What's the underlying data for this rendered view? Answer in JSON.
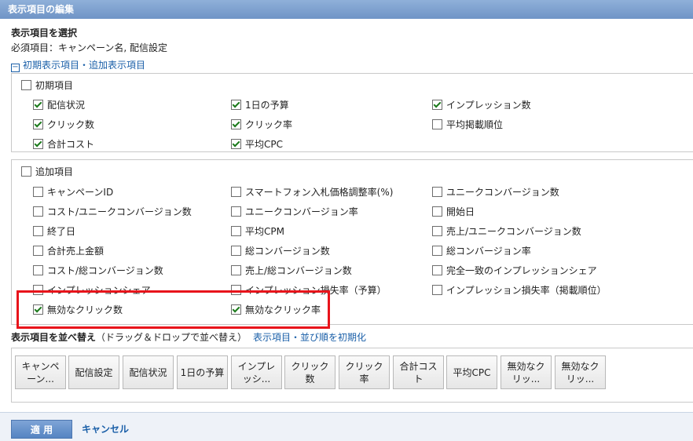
{
  "window_title": "表示項目の編集",
  "section_title": "表示項目を選択",
  "required_text": "必須項目：キャンペーン名, 配信設定",
  "toggle_label": "初期表示項目・追加表示項目",
  "initial": {
    "header": {
      "label": "初期項目",
      "checked": false
    },
    "items": [
      {
        "label": "配信状況",
        "checked": true
      },
      {
        "label": "1日の予算",
        "checked": true
      },
      {
        "label": "インプレッション数",
        "checked": true
      },
      {
        "label": "クリック数",
        "checked": true
      },
      {
        "label": "クリック率",
        "checked": true
      },
      {
        "label": "平均掲載順位",
        "checked": false
      },
      {
        "label": "合計コスト",
        "checked": true
      },
      {
        "label": "平均CPC",
        "checked": true
      }
    ]
  },
  "additional": {
    "header": {
      "label": "追加項目",
      "checked": false
    },
    "items": [
      {
        "label": "キャンペーンID",
        "checked": false
      },
      {
        "label": "スマートフォン入札価格調整率(%)",
        "checked": false
      },
      {
        "label": "ユニークコンバージョン数",
        "checked": false
      },
      {
        "label": "コスト/ユニークコンバージョン数",
        "checked": false
      },
      {
        "label": "ユニークコンバージョン率",
        "checked": false
      },
      {
        "label": "開始日",
        "checked": false
      },
      {
        "label": "終了日",
        "checked": false
      },
      {
        "label": "平均CPM",
        "checked": false
      },
      {
        "label": "売上/ユニークコンバージョン数",
        "checked": false
      },
      {
        "label": "合計売上金額",
        "checked": false
      },
      {
        "label": "総コンバージョン数",
        "checked": false
      },
      {
        "label": "総コンバージョン率",
        "checked": false
      },
      {
        "label": "コスト/総コンバージョン数",
        "checked": false
      },
      {
        "label": "売上/総コンバージョン数",
        "checked": false
      },
      {
        "label": "完全一致のインプレッションシェア",
        "checked": false
      },
      {
        "label": "インプレッションシェア",
        "checked": false
      },
      {
        "label": "インプレッション損失率（予算）",
        "checked": false
      },
      {
        "label": "インプレッション損失率（掲載順位）",
        "checked": false
      },
      {
        "label": "無効なクリック数",
        "checked": true
      },
      {
        "label": "無効なクリック率",
        "checked": true
      }
    ]
  },
  "reorder": {
    "title": "表示項目を並べ替え",
    "hint": "（ドラッグ＆ドロップで並べ替え）",
    "reset_link": "表示項目・並び順を初期化",
    "chips": [
      "キャンペーン...",
      "配信設定",
      "配信状況",
      "1日の予算",
      "インプレッシ...",
      "クリック数",
      "クリック率",
      "合計コスト",
      "平均CPC",
      "無効なクリッ...",
      "無効なクリッ..."
    ]
  },
  "footer": {
    "apply_label": "適 用",
    "cancel_label": "キャンセル"
  },
  "colors": {
    "title_bar": "#7a9dce",
    "link": "#1a5fa8",
    "highlight": "#e8141b"
  }
}
